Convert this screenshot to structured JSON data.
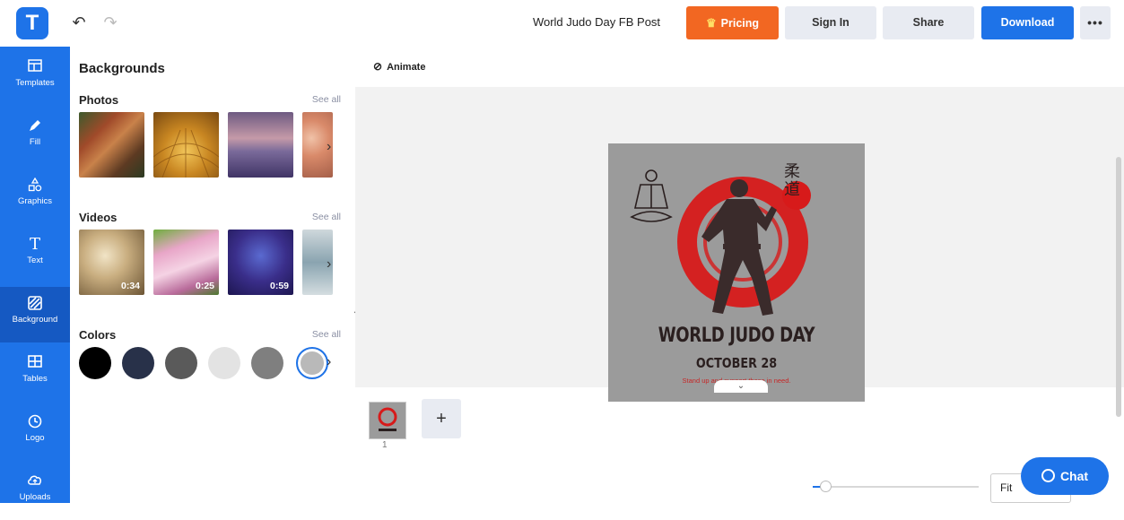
{
  "topbar": {
    "doc_title": "World Judo Day FB Post",
    "pricing": "Pricing",
    "signin": "Sign In",
    "share": "Share",
    "download": "Download",
    "more": "•••"
  },
  "sidebar": {
    "items": [
      {
        "label": "Templates",
        "icon": "templates-icon"
      },
      {
        "label": "Fill",
        "icon": "pencil-icon"
      },
      {
        "label": "Graphics",
        "icon": "shapes-icon"
      },
      {
        "label": "Text",
        "icon": "text-icon"
      },
      {
        "label": "Background",
        "icon": "background-icon"
      },
      {
        "label": "Tables",
        "icon": "table-icon"
      },
      {
        "label": "Logo",
        "icon": "logo-icon"
      },
      {
        "label": "Uploads",
        "icon": "cloud-upload-icon"
      }
    ],
    "active_index": 4
  },
  "panel": {
    "title": "Backgrounds",
    "photos": {
      "title": "Photos",
      "see_all": "See all"
    },
    "videos": {
      "title": "Videos",
      "see_all": "See all",
      "durations": [
        "0:34",
        "0:25",
        "0:59"
      ]
    },
    "colors": {
      "title": "Colors",
      "see_all": "See all",
      "swatches": [
        "#000000",
        "#283149",
        "#5a5a5a",
        "#e3e3e3",
        "#7f7f7f",
        "#b9b9b9"
      ]
    }
  },
  "canvas": {
    "animate": "Animate",
    "poster": {
      "title": "WORLD JUDO DAY",
      "date": "OCTOBER 28",
      "tagline": "Stand up and support those in need.",
      "kanji": "柔道",
      "bg": "#9b9b9b",
      "accent": "#d71a1a"
    },
    "page_number": "1",
    "add_page": "+"
  },
  "bottom": {
    "zoom_label": "Fit",
    "zoom_level": 0.05,
    "chat_label": "Chat"
  },
  "colors": {
    "brand": "#1e73e8",
    "pricing": "#f26722",
    "button_grey": "#e8ebf2"
  }
}
